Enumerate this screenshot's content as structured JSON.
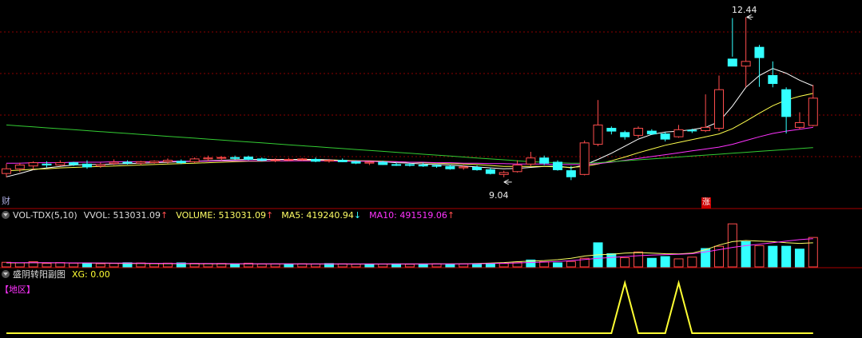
{
  "colors": {
    "up": "#ff4d4d",
    "down": "#33ffff",
    "ma_short": "#ffffff",
    "ma_mid": "#ffff4d",
    "ma_long": "#ff33ff",
    "ma_longest": "#33cc33",
    "grid": "#8b0000",
    "xg": "#ffff33",
    "volume_ma5": "#ffff66",
    "volume_ma10": "#ff33ff"
  },
  "main_panel": {
    "high_label": "12.44",
    "low_label": "9.04",
    "marker_left": "财",
    "marker_right": "涨"
  },
  "volume_panel": {
    "indicator": "VOL-TDX(5,10)",
    "vvol_label": "VVOL: 513031.09",
    "vvol_arrow": "↑",
    "volume_label": "VOLUME: 513031.09",
    "volume_arrow": "↑",
    "ma5_label": "MA5: 419240.94",
    "ma5_arrow": "↓",
    "ma10_label": "MA10: 491519.06",
    "ma10_arrow": "↑"
  },
  "sub_panel": {
    "name": "盛阴转阳副图",
    "xg_label": "XG: 0.00",
    "region_label": "【地区】"
  },
  "chart_data": [
    {
      "type": "candlestick",
      "title": "",
      "ylim": [
        8.8,
        12.6
      ],
      "annotations": [
        {
          "text": "12.44",
          "at": "highest high"
        },
        {
          "text": "9.04",
          "at": "lowest low"
        }
      ],
      "candles": [
        {
          "o": 9.12,
          "h": 9.33,
          "l": 9.04,
          "c": 9.22
        },
        {
          "o": 9.22,
          "h": 9.35,
          "l": 9.15,
          "c": 9.3
        },
        {
          "o": 9.28,
          "h": 9.38,
          "l": 9.2,
          "c": 9.35
        },
        {
          "o": 9.32,
          "h": 9.38,
          "l": 9.25,
          "c": 9.3
        },
        {
          "o": 9.3,
          "h": 9.4,
          "l": 9.28,
          "c": 9.35
        },
        {
          "o": 9.35,
          "h": 9.37,
          "l": 9.28,
          "c": 9.31
        },
        {
          "o": 9.32,
          "h": 9.4,
          "l": 9.22,
          "c": 9.26
        },
        {
          "o": 9.28,
          "h": 9.35,
          "l": 9.24,
          "c": 9.31
        },
        {
          "o": 9.33,
          "h": 9.42,
          "l": 9.3,
          "c": 9.36
        },
        {
          "o": 9.36,
          "h": 9.4,
          "l": 9.31,
          "c": 9.34
        },
        {
          "o": 9.34,
          "h": 9.39,
          "l": 9.3,
          "c": 9.37
        },
        {
          "o": 9.35,
          "h": 9.4,
          "l": 9.33,
          "c": 9.38
        },
        {
          "o": 9.37,
          "h": 9.44,
          "l": 9.33,
          "c": 9.4
        },
        {
          "o": 9.38,
          "h": 9.42,
          "l": 9.32,
          "c": 9.35
        },
        {
          "o": 9.37,
          "h": 9.46,
          "l": 9.34,
          "c": 9.43
        },
        {
          "o": 9.43,
          "h": 9.5,
          "l": 9.38,
          "c": 9.45
        },
        {
          "o": 9.45,
          "h": 9.49,
          "l": 9.4,
          "c": 9.46
        },
        {
          "o": 9.46,
          "h": 9.5,
          "l": 9.42,
          "c": 9.44
        },
        {
          "o": 9.47,
          "h": 9.5,
          "l": 9.4,
          "c": 9.42
        },
        {
          "o": 9.43,
          "h": 9.46,
          "l": 9.38,
          "c": 9.4
        },
        {
          "o": 9.4,
          "h": 9.44,
          "l": 9.36,
          "c": 9.41
        },
        {
          "o": 9.41,
          "h": 9.45,
          "l": 9.38,
          "c": 9.42
        },
        {
          "o": 9.42,
          "h": 9.45,
          "l": 9.39,
          "c": 9.43
        },
        {
          "o": 9.42,
          "h": 9.46,
          "l": 9.36,
          "c": 9.38
        },
        {
          "o": 9.39,
          "h": 9.43,
          "l": 9.35,
          "c": 9.4
        },
        {
          "o": 9.4,
          "h": 9.44,
          "l": 9.36,
          "c": 9.37
        },
        {
          "o": 9.37,
          "h": 9.4,
          "l": 9.32,
          "c": 9.34
        },
        {
          "o": 9.34,
          "h": 9.38,
          "l": 9.3,
          "c": 9.36
        },
        {
          "o": 9.36,
          "h": 9.39,
          "l": 9.3,
          "c": 9.31
        },
        {
          "o": 9.31,
          "h": 9.35,
          "l": 9.28,
          "c": 9.3
        },
        {
          "o": 9.31,
          "h": 9.34,
          "l": 9.27,
          "c": 9.3
        },
        {
          "o": 9.3,
          "h": 9.35,
          "l": 9.26,
          "c": 9.28
        },
        {
          "o": 9.29,
          "h": 9.32,
          "l": 9.24,
          "c": 9.28
        },
        {
          "o": 9.27,
          "h": 9.31,
          "l": 9.2,
          "c": 9.22
        },
        {
          "o": 9.24,
          "h": 9.3,
          "l": 9.2,
          "c": 9.26
        },
        {
          "o": 9.25,
          "h": 9.29,
          "l": 9.18,
          "c": 9.2
        },
        {
          "o": 9.2,
          "h": 9.25,
          "l": 9.1,
          "c": 9.12
        },
        {
          "o": 9.1,
          "h": 9.18,
          "l": 9.04,
          "c": 9.14
        },
        {
          "o": 9.16,
          "h": 9.4,
          "l": 9.14,
          "c": 9.3
        },
        {
          "o": 9.32,
          "h": 9.58,
          "l": 9.28,
          "c": 9.45
        },
        {
          "o": 9.45,
          "h": 9.5,
          "l": 9.3,
          "c": 9.34
        },
        {
          "o": 9.36,
          "h": 9.4,
          "l": 9.18,
          "c": 9.2
        },
        {
          "o": 9.18,
          "h": 9.28,
          "l": 8.98,
          "c": 9.05
        },
        {
          "o": 9.1,
          "h": 9.82,
          "l": 9.08,
          "c": 9.77
        },
        {
          "o": 9.74,
          "h": 10.68,
          "l": 9.7,
          "c": 10.15
        },
        {
          "o": 10.08,
          "h": 10.12,
          "l": 9.95,
          "c": 10.02
        },
        {
          "o": 9.99,
          "h": 10.03,
          "l": 9.84,
          "c": 9.9
        },
        {
          "o": 9.93,
          "h": 10.12,
          "l": 9.88,
          "c": 10.08
        },
        {
          "o": 10.02,
          "h": 10.06,
          "l": 9.94,
          "c": 9.96
        },
        {
          "o": 9.96,
          "h": 10.0,
          "l": 9.8,
          "c": 9.85
        },
        {
          "o": 9.9,
          "h": 10.15,
          "l": 9.88,
          "c": 10.05
        },
        {
          "o": 10.04,
          "h": 10.07,
          "l": 9.98,
          "c": 10.03
        },
        {
          "o": 10.03,
          "h": 10.8,
          "l": 10.0,
          "c": 10.1
        },
        {
          "o": 10.08,
          "h": 11.2,
          "l": 10.02,
          "c": 10.9
        },
        {
          "o": 11.55,
          "h": 12.42,
          "l": 11.6,
          "c": 11.4
        },
        {
          "o": 11.4,
          "h": 12.44,
          "l": 10.95,
          "c": 11.5
        },
        {
          "o": 11.8,
          "h": 11.85,
          "l": 10.96,
          "c": 11.58
        },
        {
          "o": 11.2,
          "h": 11.5,
          "l": 10.95,
          "c": 11.03
        },
        {
          "o": 10.9,
          "h": 10.95,
          "l": 9.97,
          "c": 10.33
        },
        {
          "o": 10.1,
          "h": 10.42,
          "l": 10.06,
          "c": 10.2
        },
        {
          "o": 10.14,
          "h": 11.0,
          "l": 10.12,
          "c": 10.72
        }
      ],
      "moving_averages": [
        {
          "name": "short",
          "values": [
            9.05,
            9.12,
            9.2,
            9.24,
            9.27,
            9.3,
            9.31,
            9.31,
            9.32,
            9.33,
            9.34,
            9.35,
            9.36,
            9.37,
            9.38,
            9.39,
            9.4,
            9.41,
            9.42,
            9.42,
            9.42,
            9.42,
            9.42,
            9.42,
            9.41,
            9.4,
            9.39,
            9.38,
            9.37,
            9.35,
            9.34,
            9.32,
            9.31,
            9.3,
            9.28,
            9.26,
            9.24,
            9.22,
            9.23,
            9.25,
            9.27,
            9.28,
            9.24,
            9.3,
            9.42,
            9.55,
            9.7,
            9.85,
            9.95,
            10.0,
            10.02,
            10.05,
            10.1,
            10.22,
            10.55,
            10.95,
            11.2,
            11.35,
            11.25,
            11.1,
            10.98
          ]
        },
        {
          "name": "mid",
          "values": [
            9.18,
            9.19,
            9.21,
            9.22,
            9.24,
            9.25,
            9.26,
            9.27,
            9.28,
            9.29,
            9.3,
            9.31,
            9.32,
            9.33,
            9.34,
            9.35,
            9.36,
            9.37,
            9.38,
            9.38,
            9.39,
            9.39,
            9.4,
            9.4,
            9.4,
            9.4,
            9.39,
            9.39,
            9.38,
            9.37,
            9.36,
            9.35,
            9.34,
            9.33,
            9.32,
            9.31,
            9.29,
            9.27,
            9.27,
            9.27,
            9.27,
            9.26,
            9.25,
            9.27,
            9.32,
            9.39,
            9.47,
            9.56,
            9.64,
            9.72,
            9.78,
            9.84,
            9.9,
            9.96,
            10.07,
            10.23,
            10.4,
            10.56,
            10.68,
            10.76,
            10.82
          ]
        },
        {
          "name": "long",
          "values": [
            9.34,
            9.34,
            9.35,
            9.35,
            9.35,
            9.36,
            9.36,
            9.36,
            9.37,
            9.37,
            9.37,
            9.37,
            9.38,
            9.38,
            9.38,
            9.38,
            9.39,
            9.39,
            9.39,
            9.39,
            9.39,
            9.39,
            9.39,
            9.39,
            9.39,
            9.38,
            9.38,
            9.38,
            9.37,
            9.37,
            9.36,
            9.36,
            9.35,
            9.35,
            9.34,
            9.34,
            9.33,
            9.33,
            9.32,
            9.32,
            9.32,
            9.31,
            9.31,
            9.31,
            9.33,
            9.36,
            9.4,
            9.44,
            9.48,
            9.52,
            9.56,
            9.6,
            9.64,
            9.68,
            9.74,
            9.82,
            9.9,
            9.97,
            10.02,
            10.06,
            10.1
          ]
        },
        {
          "name": "longest",
          "values": [
            10.15,
            10.13,
            10.11,
            10.09,
            10.07,
            10.05,
            10.03,
            10.01,
            9.99,
            9.97,
            9.95,
            9.93,
            9.91,
            9.89,
            9.87,
            9.85,
            9.83,
            9.81,
            9.79,
            9.77,
            9.75,
            9.73,
            9.71,
            9.69,
            9.67,
            9.65,
            9.63,
            9.61,
            9.59,
            9.57,
            9.55,
            9.53,
            9.51,
            9.49,
            9.47,
            9.45,
            9.43,
            9.41,
            9.39,
            9.37,
            9.36,
            9.35,
            9.34,
            9.34,
            9.35,
            9.37,
            9.39,
            9.41,
            9.43,
            9.45,
            9.47,
            9.49,
            9.51,
            9.53,
            9.55,
            9.57,
            9.59,
            9.61,
            9.63,
            9.65,
            9.67
          ]
        }
      ]
    },
    {
      "type": "bar",
      "title": "VOL-TDX(5,10)",
      "values": [
        80000,
        70000,
        90000,
        60000,
        75000,
        65000,
        70000,
        55000,
        60000,
        72000,
        68000,
        60000,
        65000,
        70000,
        62000,
        58000,
        60000,
        55000,
        64000,
        50000,
        52000,
        48000,
        55000,
        50000,
        58000,
        52000,
        46000,
        50000,
        48000,
        52000,
        45000,
        50000,
        55000,
        48000,
        52000,
        50000,
        58000,
        60000,
        85000,
        120000,
        90000,
        70000,
        95000,
        150000,
        420000,
        230000,
        160000,
        260000,
        150000,
        180000,
        140000,
        170000,
        320000,
        360000,
        750000,
        440000,
        370000,
        360000,
        360000,
        310000,
        513031
      ],
      "down_bars": [
        6,
        9,
        13,
        17,
        21,
        24,
        27,
        29,
        31,
        33,
        35,
        36,
        39,
        41,
        44,
        45,
        48,
        49,
        52,
        55,
        57,
        58,
        59
      ],
      "ma5": [
        70000,
        70000,
        72000,
        71000,
        70000,
        68000,
        66000,
        64000,
        62000,
        60000,
        58000,
        57000,
        56000,
        56000,
        55000,
        54000,
        53000,
        53000,
        52000,
        52000,
        51000,
        51000,
        50000,
        50000,
        50000,
        49000,
        49000,
        49000,
        49000,
        49000,
        50000,
        50000,
        51000,
        52000,
        55000,
        58000,
        65000,
        75000,
        90000,
        100000,
        110000,
        125000,
        150000,
        190000,
        210000,
        220000,
        240000,
        250000,
        240000,
        230000,
        225000,
        240000,
        300000,
        380000,
        440000,
        460000,
        450000,
        440000,
        420000,
        410000,
        419240
      ],
      "ma10": [
        75000,
        74000,
        73000,
        72000,
        71000,
        70000,
        69000,
        68000,
        67000,
        66000,
        64000,
        62000,
        61000,
        60000,
        59000,
        58000,
        57000,
        56000,
        56000,
        55000,
        54000,
        54000,
        53000,
        53000,
        52000,
        52000,
        51000,
        51000,
        51000,
        51000,
        51000,
        51000,
        51000,
        52000,
        53000,
        55000,
        58000,
        62000,
        68000,
        76000,
        84000,
        95000,
        110000,
        130000,
        150000,
        165000,
        180000,
        195000,
        205000,
        215000,
        220000,
        230000,
        260000,
        300000,
        340000,
        370000,
        395000,
        420000,
        450000,
        475000,
        491519
      ]
    },
    {
      "type": "line",
      "title": "盛阴转阳副图",
      "series": [
        {
          "name": "XG",
          "values": [
            0,
            0,
            0,
            0,
            0,
            0,
            0,
            0,
            0,
            0,
            0,
            0,
            0,
            0,
            0,
            0,
            0,
            0,
            0,
            0,
            0,
            0,
            0,
            0,
            0,
            0,
            0,
            0,
            0,
            0,
            0,
            0,
            0,
            0,
            0,
            0,
            0,
            0,
            0,
            0,
            0,
            0,
            0,
            0,
            0,
            0,
            1,
            0,
            0,
            0,
            1,
            0,
            0,
            0,
            0,
            0,
            0,
            0,
            0,
            0,
            0
          ]
        }
      ],
      "ylim": [
        0,
        1
      ]
    }
  ]
}
